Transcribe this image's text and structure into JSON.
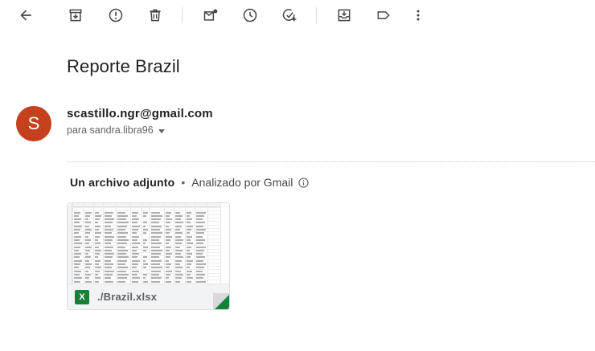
{
  "toolbar": {
    "icons": [
      "back-arrow-icon",
      "archive-icon",
      "report-spam-icon",
      "delete-icon",
      "mark-unread-icon",
      "snooze-icon",
      "add-task-icon",
      "move-to-icon",
      "label-icon",
      "more-vert-icon"
    ]
  },
  "email": {
    "subject": "Reporte Brazil",
    "sender": {
      "initial": "S",
      "address": "scastillo.ngr@gmail.com",
      "avatar_color": "#c5401d"
    },
    "recipient": "para sandra.libra96"
  },
  "attachments": {
    "title": "Un archivo adjunto",
    "separator": "•",
    "scanned_by": "Analizado por Gmail",
    "files": [
      {
        "name": "./Brazil.xlsx",
        "type_badge": "X",
        "type_color": "#188038"
      }
    ]
  }
}
